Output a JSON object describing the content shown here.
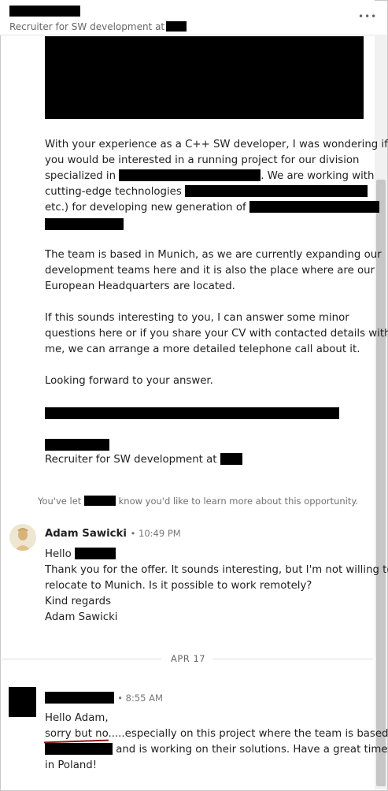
{
  "header": {
    "subtitle": "Recruiter for SW development at",
    "more_icon": "more-icon"
  },
  "recruiter_message": {
    "p1_l1": "With your experience as a C++ SW developer, I was wondering if",
    "p1_l2": "you would be interested in a running project for our division",
    "p1_l3a": "specialized in",
    "p1_l3b": ". We are working with",
    "p1_l4a": "cutting-edge technologies",
    "p1_l5a": "etc.) for developing new generation of",
    "p2_l1": "The team is based in Munich, as we are currently expanding our",
    "p2_l2": "development teams here and it is also the place where are our",
    "p2_l3": "European Headquarters are located.",
    "p3_l1": "If this sounds interesting to you, I can answer some minor",
    "p3_l2": "questions here or if you share your CV with contacted details with",
    "p3_l3": "me, we can arrange a more detailed telephone call about it.",
    "p4": "Looking forward to your answer.",
    "signature_title": "Recruiter for SW development at"
  },
  "system_note": {
    "prefix": "You've let",
    "suffix": "know you'd like to learn more about this opportunity."
  },
  "reply": {
    "sender": "Adam Sawicki",
    "time": "• 10:49 PM",
    "greeting": "Hello",
    "l1": "Thank you for the offer. It sounds interesting, but I'm not willing to",
    "l2": "relocate to Munich. Is it possible to work remotely?",
    "l3": "Kind regards",
    "l4": "Adam Sawicki"
  },
  "date_divider": "APR 17",
  "final_message": {
    "time": "• 8:55 AM",
    "l1": "Hello Adam,",
    "l2a": "sorry but no",
    "l2b": ".....especially on this project where the team is based in",
    "l3b": "and is working on their solutions. Have a great time",
    "l4": "in Poland!"
  }
}
